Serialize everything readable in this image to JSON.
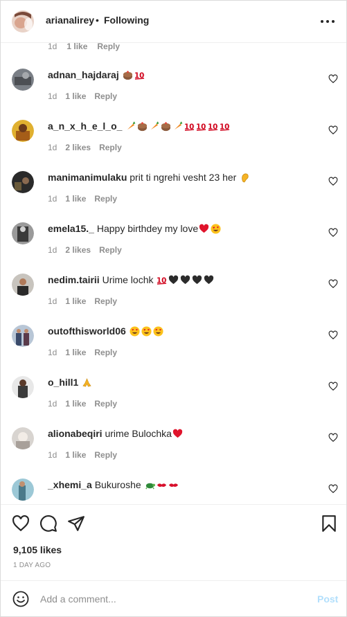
{
  "header": {
    "username": "arianalirey",
    "separator": "•",
    "follow_status": "Following"
  },
  "partial_comment": {
    "time": "1d",
    "likes": "1 like",
    "reply": "Reply"
  },
  "comments": [
    {
      "username": "adnan_hajdaraj",
      "text": "",
      "emojis": [
        "cake",
        "hundred"
      ],
      "time": "1d",
      "likes": "1 like",
      "reply": "Reply"
    },
    {
      "username": "a_n_x_h_e_l_o_",
      "text": "",
      "emojis": [
        "carrot",
        "cake",
        "carrot",
        "cake",
        "carrot",
        "hundred",
        "hundred",
        "hundred",
        "hundred"
      ],
      "time": "1d",
      "likes": "2 likes",
      "reply": "Reply"
    },
    {
      "username": "manimanimulaku",
      "text": "prit ti ngrehi vesht 23 her",
      "emojis": [
        "ear"
      ],
      "time": "1d",
      "likes": "1 like",
      "reply": "Reply"
    },
    {
      "username": "emela15._",
      "text": "Happy birthdey my love",
      "emojis": [
        "red-heart",
        "heart-eyes"
      ],
      "time": "1d",
      "likes": "2 likes",
      "reply": "Reply"
    },
    {
      "username": "nedim.tairii",
      "text": "Urime lochk",
      "emojis": [
        "hundred",
        "black-heart",
        "black-heart",
        "black-heart",
        "black-heart"
      ],
      "time": "1d",
      "likes": "1 like",
      "reply": "Reply"
    },
    {
      "username": "outofthisworld06",
      "text": "",
      "emojis": [
        "heart-eyes",
        "heart-eyes",
        "heart-eyes"
      ],
      "time": "1d",
      "likes": "1 like",
      "reply": "Reply"
    },
    {
      "username": "o_hill1",
      "text": "",
      "emojis": [
        "folded-hands"
      ],
      "time": "1d",
      "likes": "1 like",
      "reply": "Reply"
    },
    {
      "username": "alionabeqiri",
      "text": "urime Bulochka",
      "emojis": [
        "red-heart"
      ],
      "time": "1d",
      "likes": "1 like",
      "reply": "Reply"
    },
    {
      "username": "_xhemi_a",
      "text": "Bukuroshe",
      "emojis": [
        "turtle",
        "kiss",
        "kiss"
      ],
      "time": "",
      "likes": "",
      "reply": ""
    }
  ],
  "post": {
    "likes": "9,105 likes",
    "time_ago": "1 DAY AGO"
  },
  "add_comment": {
    "placeholder": "Add a comment...",
    "post_label": "Post"
  },
  "icons": {
    "like": "heart-outline-icon",
    "comment": "comment-bubble-icon",
    "share": "paper-plane-icon",
    "save": "bookmark-icon",
    "emoji": "smiley-icon",
    "more": "ellipsis-icon"
  },
  "colors": {
    "text": "#262626",
    "secondary": "#8e8e8e",
    "post_disabled": "#b2dffc",
    "border": "#dbdbdb"
  }
}
